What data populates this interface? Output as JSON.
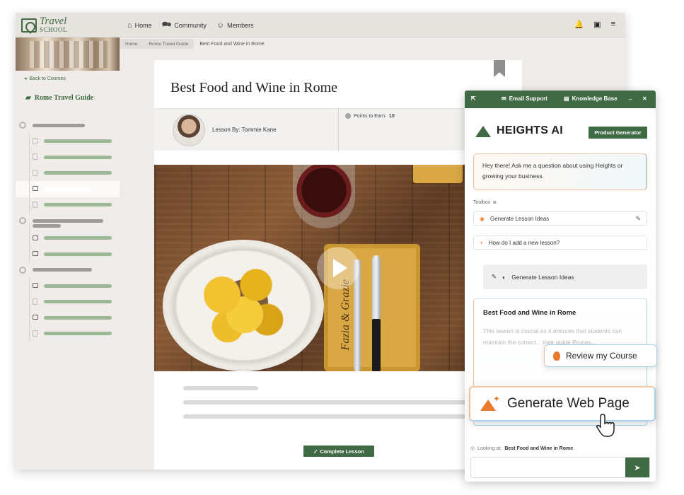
{
  "logo": {
    "line1": "Travel",
    "line2": "SCHOOL"
  },
  "nav": [
    {
      "label": "Home",
      "icon": "home-icon"
    },
    {
      "label": "Community",
      "icon": "chat-icon"
    },
    {
      "label": "Members",
      "icon": "people-icon"
    }
  ],
  "top_icons": [
    "bell-icon",
    "inbox-icon",
    "menu-icon"
  ],
  "sidebar": {
    "back_label": "Back to Courses",
    "course_title": "Rome Travel Guide"
  },
  "breadcrumb": [
    "Home",
    "Rome Travel Guide",
    "Best Food and Wine in Rome"
  ],
  "lesson": {
    "title": "Best Food and Wine in Rome",
    "by_label": "Lesson By: Tommie Kane",
    "points_label": "Points to Earn:",
    "points_value": "10",
    "complete_label": "Complete Lesson",
    "board_text": "Fazia & Grazie"
  },
  "ai_panel": {
    "header": {
      "support": "Email Support",
      "knowledge": "Knowledge Base"
    },
    "brand": "HEIGHTS AI",
    "product_btn": "Product Generator",
    "greeting": "Hey there! Ask me a question about using Heights or growing your business.",
    "toolbox_label": "Toolbox",
    "tool_1": "Generate Lesson Ideas",
    "tool_2": "How do I add a new lesson?",
    "gen_ideas": "Generate Lesson Ideas",
    "doc_title": "Best Food and Wine in Rome",
    "doc_body": "This lesson is crucial as it ensures that students can maintain the correct... their guide Proces...",
    "review_label": "Review my Course",
    "generate_label": "Generate Web Page",
    "looking_label": "Looking at:",
    "looking_value": "Best Food and Wine in Rome"
  },
  "colors": {
    "brand_green": "#3f6a43",
    "accent_orange": "#ea7a2c",
    "accent_blue": "#a9d2ea"
  }
}
